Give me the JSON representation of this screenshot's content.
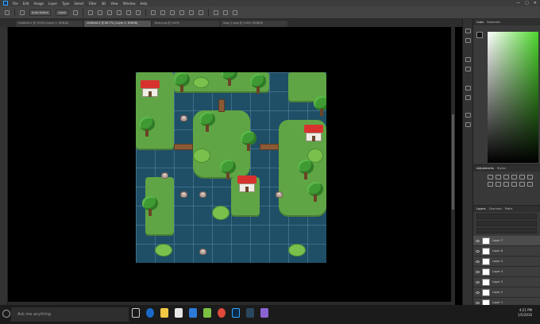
{
  "menubar": {
    "items": [
      "File",
      "Edit",
      "Image",
      "Layer",
      "Type",
      "Select",
      "Filter",
      "3D",
      "View",
      "Window",
      "Help"
    ],
    "window_controls": [
      "—",
      "▢",
      "✕"
    ]
  },
  "options": {
    "fields": [
      "Auto-Select:",
      "Layer"
    ]
  },
  "tabs": [
    {
      "label": "Untitled-1 @ 100% (Layer 1, RGB/8)",
      "active": false
    },
    {
      "label": "Untitled-2 @ 66.7% (Layer 2, RGB/8)",
      "active": true
    },
    {
      "label": "tiles.png @ 100%",
      "active": false
    },
    {
      "label": "map_1.png @ 100% (RGB/8)",
      "active": false
    }
  ],
  "panels": {
    "color_tabs": [
      "Color",
      "Swatches"
    ],
    "adjustments_tabs": [
      "Adjustments",
      "Styles"
    ],
    "layers_tabs": [
      "Layers",
      "Channels",
      "Paths"
    ],
    "layers": [
      {
        "name": "Layer 7",
        "selected": true
      },
      {
        "name": "Layer 6",
        "selected": false
      },
      {
        "name": "Layer 5",
        "selected": false
      },
      {
        "name": "Layer 4",
        "selected": false
      },
      {
        "name": "Layer 3",
        "selected": false
      },
      {
        "name": "Layer 2",
        "selected": false
      },
      {
        "name": "Layer 1",
        "selected": false
      }
    ]
  },
  "colors": {
    "foreground": "#141414",
    "background": "#ffffff",
    "picker_hue": "#4cd62b",
    "water": "#1f4f66",
    "grass": "#5fa545",
    "roof": "#d8322f"
  },
  "taskbar": {
    "search_placeholder": "Ask me anything",
    "time": "4:21 PM",
    "date": "1/5/2016",
    "apps": [
      "task-view",
      "edge",
      "file-explorer",
      "store",
      "mail",
      "calendar",
      "chrome",
      "photoshop",
      "steam",
      "other"
    ]
  }
}
